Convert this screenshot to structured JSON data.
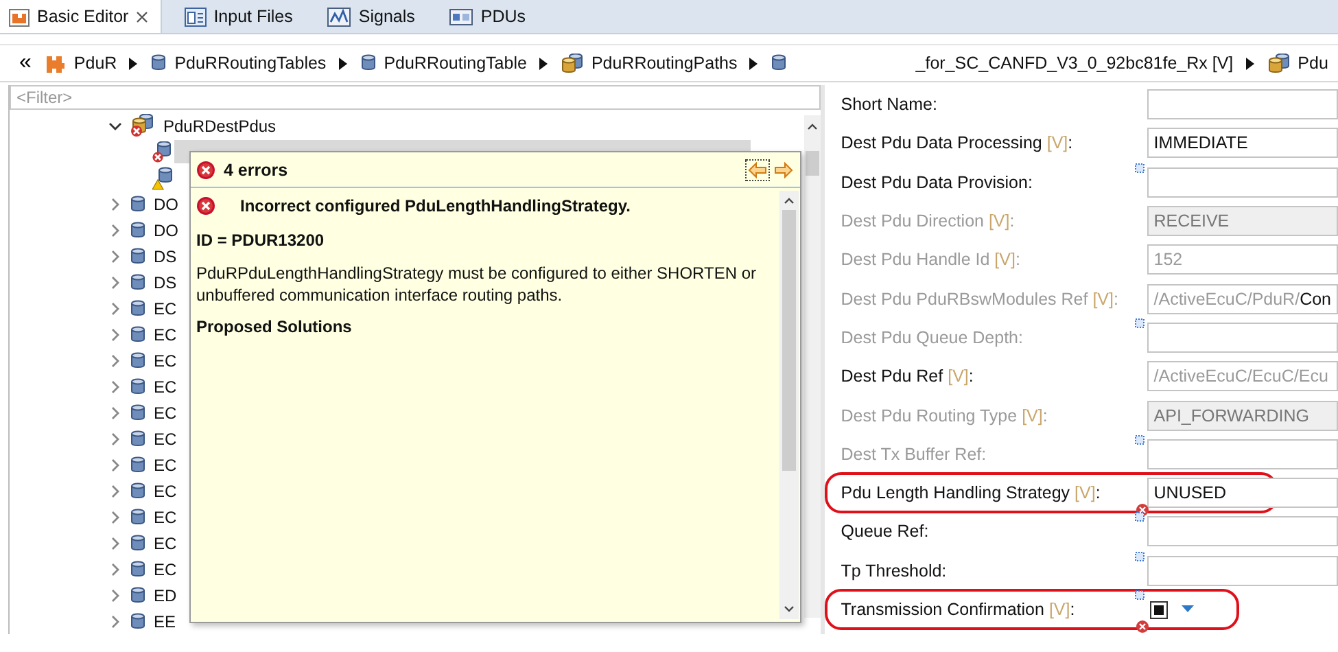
{
  "tabs": [
    {
      "label": "Basic Editor",
      "selected": true,
      "closable": true
    },
    {
      "label": "Input Files",
      "selected": false
    },
    {
      "label": "Signals",
      "selected": false
    },
    {
      "label": "PDUs",
      "selected": false
    }
  ],
  "breadcrumb": {
    "overflow": "«",
    "items": [
      {
        "label": "PduR"
      },
      {
        "label": "PduRRoutingTables"
      },
      {
        "label": "PduRRoutingTable"
      },
      {
        "label": "PduRRoutingPaths"
      },
      {
        "label": "_for_SC_CANFD_V3_0_92bc81fe_Rx [V]"
      },
      {
        "label": "Pdu"
      }
    ]
  },
  "filter": {
    "placeholder": "<Filter>"
  },
  "tree": {
    "items": [
      {
        "label": "PduRDestPdus",
        "has_error": true,
        "expanded": true,
        "selected": false,
        "children": [
          {
            "has_error": true,
            "selected": true
          },
          {
            "has_warning": true,
            "selected": false
          }
        ]
      },
      {
        "label": "DO",
        "expanded": false,
        "selected": false
      },
      {
        "label": "DO",
        "expanded": false,
        "selected": false
      },
      {
        "label": "DS",
        "expanded": false,
        "selected": false
      },
      {
        "label": "DS",
        "expanded": false,
        "selected": false
      },
      {
        "label": "EC",
        "expanded": false,
        "selected": false
      },
      {
        "label": "EC",
        "expanded": false,
        "selected": false
      },
      {
        "label": "EC",
        "expanded": false,
        "selected": false
      },
      {
        "label": "EC",
        "expanded": false,
        "selected": false
      },
      {
        "label": "EC",
        "expanded": false,
        "selected": false
      },
      {
        "label": "EC",
        "expanded": false,
        "selected": false
      },
      {
        "label": "EC",
        "expanded": false,
        "selected": false
      },
      {
        "label": "EC",
        "expanded": false,
        "selected": false
      },
      {
        "label": "EC",
        "expanded": false,
        "selected": false
      },
      {
        "label": "EC",
        "expanded": false,
        "selected": false
      },
      {
        "label": "EC",
        "expanded": false,
        "selected": false
      },
      {
        "label": "ED",
        "expanded": false,
        "selected": false
      },
      {
        "label": "EE",
        "expanded": false,
        "selected": false
      }
    ]
  },
  "popup": {
    "title": "4 errors",
    "error": {
      "title": "Incorrect configured PduLengthHandlingStrategy.",
      "id": "ID = PDUR13200",
      "description": "PduRPduLengthHandlingStrategy must be configured to either SHORTEN or unbuffered communication interface routing paths.",
      "solutions_heading": "Proposed Solutions"
    }
  },
  "form": {
    "rows": [
      {
        "label": "Short Name:",
        "kind": "text",
        "disabled": false
      },
      {
        "label": "Dest Pdu Data Processing",
        "variant": "[V]",
        "suffix": ":",
        "kind": "text",
        "disabled": false,
        "value": "IMMEDIATE"
      },
      {
        "label": "Dest Pdu Data Provision:",
        "kind": "text",
        "disabled": false,
        "info_marker": true
      },
      {
        "label": "Dest Pdu Direction",
        "variant": "[V]",
        "suffix": ":",
        "kind": "text",
        "disabled": true,
        "field_disabled": true,
        "value": "RECEIVE"
      },
      {
        "label": "Dest Pdu Handle Id",
        "variant": "[V]",
        "suffix": ":",
        "kind": "text",
        "disabled": true,
        "value": "152",
        "value_muted": true
      },
      {
        "label": "Dest Pdu PduRBswModules Ref",
        "variant": "[V]",
        "suffix": ":",
        "kind": "text",
        "disabled": true,
        "value": "/ActiveEcuC/PduR/",
        "value_muted": true,
        "value_tail": "Con"
      },
      {
        "label": "Dest Pdu Queue Depth:",
        "kind": "text",
        "disabled": true,
        "info_marker": true
      },
      {
        "label": "Dest Pdu Ref",
        "variant": "[V]",
        "suffix": ":",
        "kind": "text",
        "disabled": false,
        "value": "/ActiveEcuC/EcuC/Ecu",
        "value_muted": true
      },
      {
        "label": "Dest Pdu Routing Type",
        "variant": "[V]",
        "suffix": ":",
        "kind": "text",
        "disabled": true,
        "field_disabled": true,
        "value": "API_FORWARDING"
      },
      {
        "label": "Dest Tx Buffer Ref:",
        "kind": "text",
        "disabled": true,
        "info_marker": true
      },
      {
        "label": "Pdu Length Handling Strategy",
        "variant": "[V]",
        "suffix": ":",
        "kind": "text",
        "disabled": false,
        "value": "UNUSED",
        "error_marker": true,
        "highlighted": true
      },
      {
        "label": "Queue Ref:",
        "kind": "text",
        "disabled": false,
        "info_marker": true
      },
      {
        "label": "Tp Threshold:",
        "kind": "text",
        "disabled": false,
        "info_marker": true
      },
      {
        "label": "Transmission Confirmation",
        "variant": "[V]",
        "suffix": ":",
        "kind": "checkbox",
        "disabled": false,
        "checked": true,
        "info_marker": true,
        "error_marker": true,
        "highlighted": true
      }
    ]
  }
}
